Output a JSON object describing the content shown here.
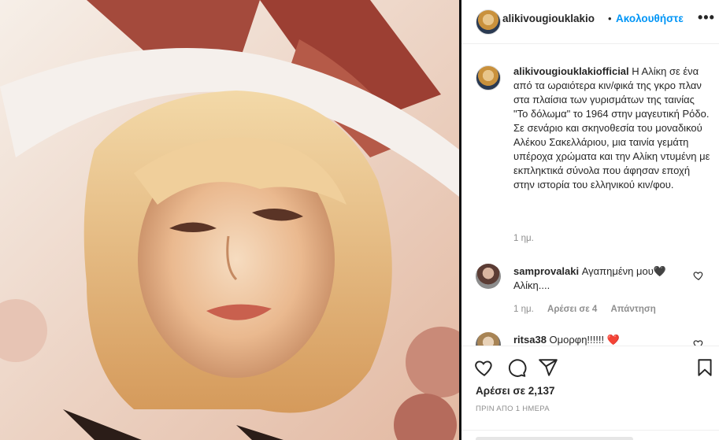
{
  "post": {
    "image_alt": "Photo of a blonde woman wearing a large white sun hat with a red bow"
  },
  "header": {
    "username": "alikivougiouklakio",
    "separator": "•",
    "follow_label": "Ακολουθήστε",
    "more_icon": "ellipsis-icon",
    "more_label": "•••"
  },
  "caption": {
    "username": "alikivougiouklakiofficial",
    "text": " Η Αλίκη σε ένα από τα ωραιότερα κιν/φικά της γκρο πλαν στα πλαίσια των γυρισμάτων της ταινίας \"Το δόλωμα\" το 1964 στην μαγευτική Ρόδο. Σε σενάριο και σκηνοθεσία του μοναδικού Αλέκου Σακελλάριου, μια ταινία γεμάτη υπέροχα χρώματα και την Αλίκη ντυμένη με εκπληκτικά σύνολα που άφησαν εποχή στην ιστορία του ελληνικού κιν/φου.",
    "time": "1 ημ."
  },
  "comments": [
    {
      "username": "samprovalaki",
      "text": " Αγαπημένη μου🖤 Αλίκη....",
      "time": "1 ημ.",
      "likes": "Αρέσει σε 4",
      "reply": "Απάντηση"
    },
    {
      "username": "ritsa38",
      "text": " Ομορφη!!!!!! ❤️"
    }
  ],
  "actions": {
    "like_icon": "heart-icon",
    "comment_icon": "comment-icon",
    "share_icon": "paper-plane-icon",
    "save_icon": "bookmark-icon",
    "likes_text": "Αρέσει σε 2,137",
    "date_text": "ΠΡΙΝ ΑΠΟ 1 ΗΜΕΡΑ"
  }
}
